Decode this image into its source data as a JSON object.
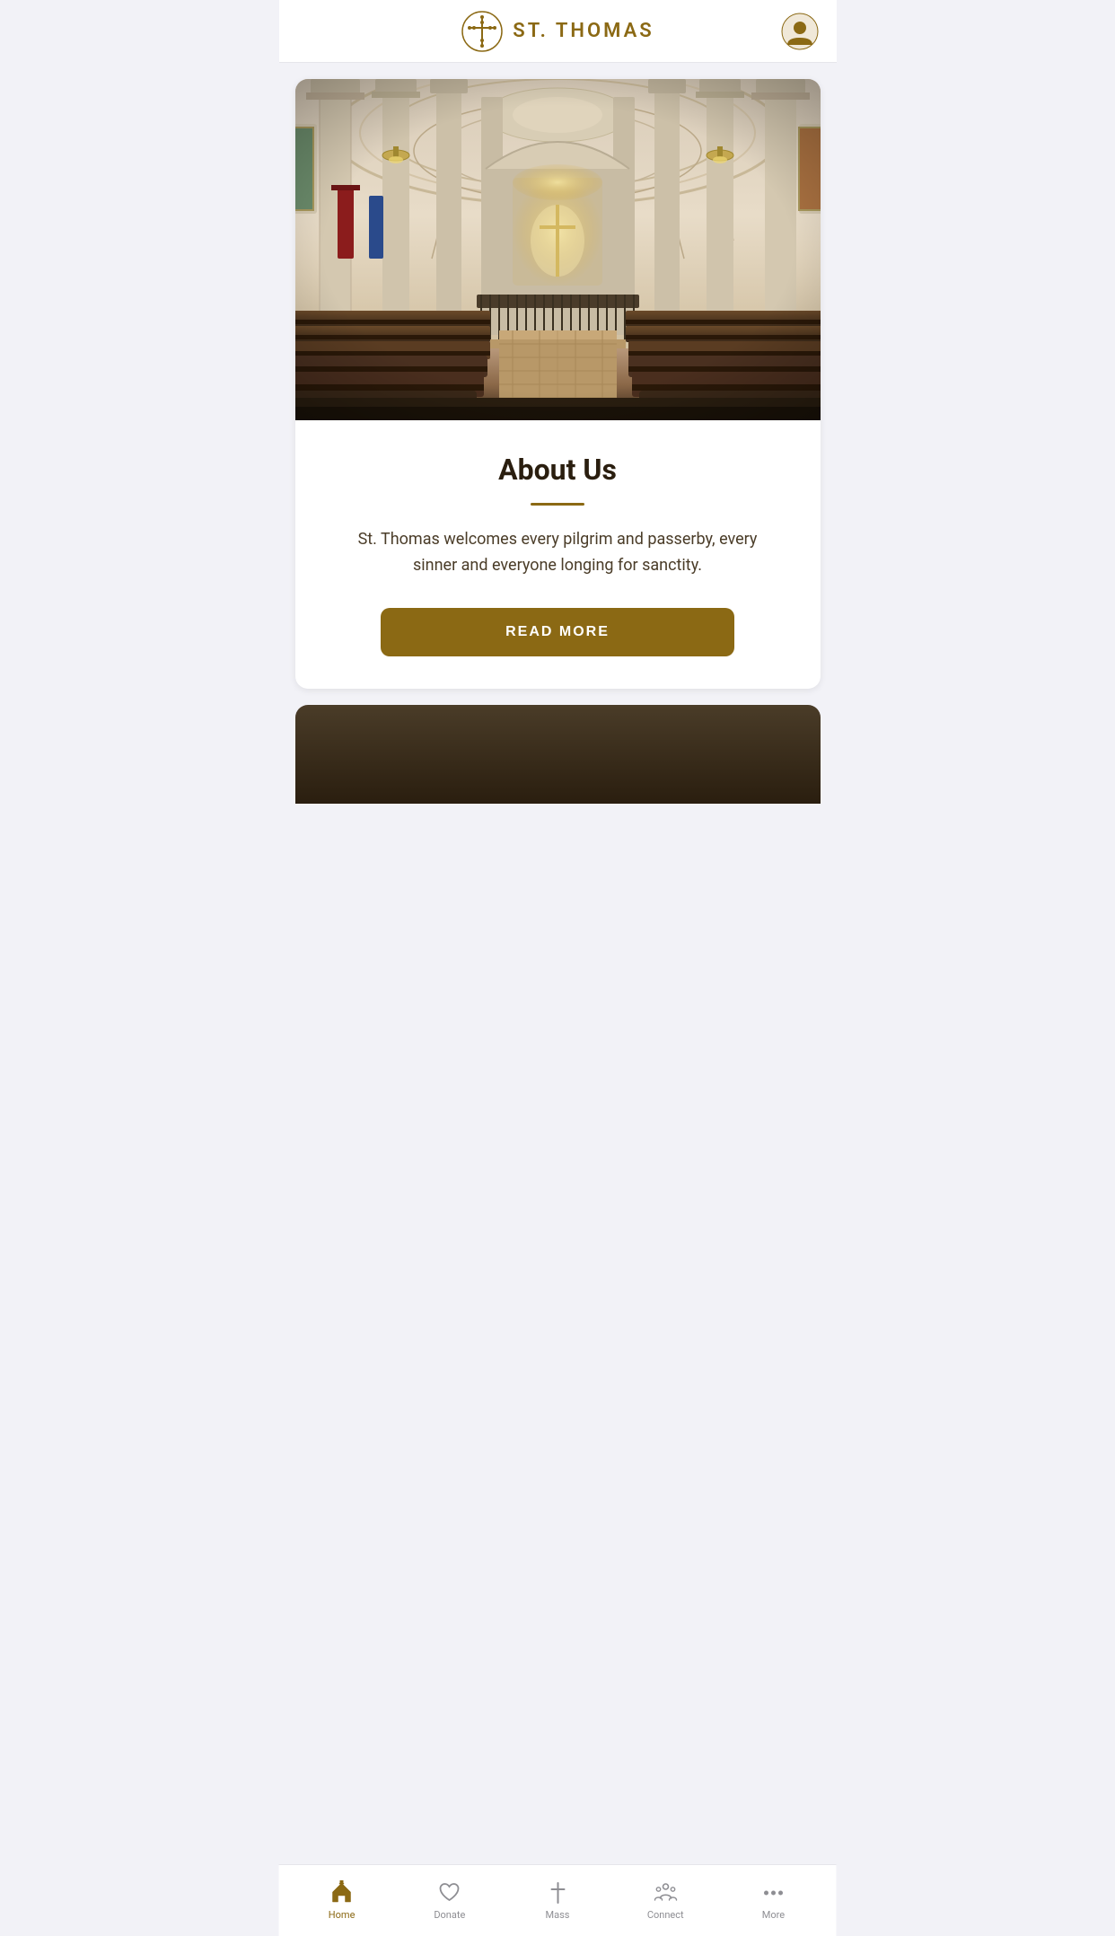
{
  "header": {
    "title": "ST. THOMAS",
    "logo_alt": "St. Thomas Cross Logo"
  },
  "hero": {
    "alt": "Church interior with pews and arched ceiling"
  },
  "about": {
    "title": "About Us",
    "description": "St. Thomas welcomes every pilgrim and passerby, every sinner and everyone longing for sanctity.",
    "read_more_label": "READ MORE"
  },
  "nav": {
    "items": [
      {
        "id": "home",
        "label": "Home",
        "active": true
      },
      {
        "id": "donate",
        "label": "Donate",
        "active": false
      },
      {
        "id": "mass",
        "label": "Mass",
        "active": false
      },
      {
        "id": "connect",
        "label": "Connect",
        "active": false
      },
      {
        "id": "more",
        "label": "More",
        "active": false
      }
    ]
  },
  "colors": {
    "brand_gold": "#8B6914",
    "text_dark": "#2a1e0f",
    "inactive_nav": "#8e8e93"
  }
}
